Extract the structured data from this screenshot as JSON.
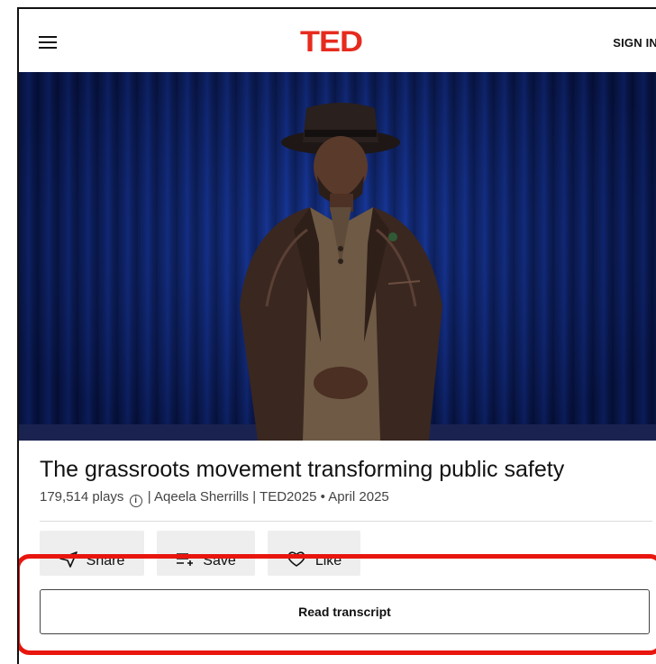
{
  "header": {
    "logo": "TED",
    "sign_in": "SIGN IN"
  },
  "talk": {
    "title": "The grassroots movement transforming public safety",
    "plays": "179,514 plays",
    "separator": "|",
    "speaker": "Aqeela Sherrills",
    "event": "TED2025",
    "date_sep": "•",
    "date": "April 2025"
  },
  "actions": {
    "share": "Share",
    "save": "Save",
    "like": "Like"
  },
  "transcript_button": "Read transcript",
  "colors": {
    "brand": "#e62b1e",
    "highlight": "#e8160e",
    "action_bg": "#eeeeee"
  }
}
